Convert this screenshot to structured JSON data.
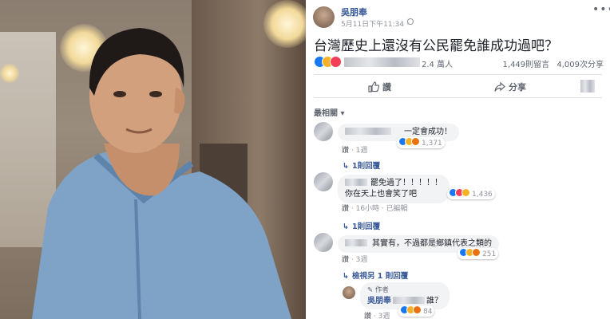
{
  "post": {
    "author": "吳朋奉",
    "time": "5月11日下午11:34 ·",
    "text": "台灣歷史上還沒有公民罷免誰成功過吧？",
    "reaction_count": "2.4 萬人",
    "comments_count": "1,449則留言",
    "shares_count": "4,009次分享"
  },
  "actions": {
    "like": "讚",
    "share": "分享"
  },
  "sort_label": "最相關 ▾",
  "comments": [
    {
      "text": "一定會成功！",
      "like": "讚",
      "age": "1週",
      "reactions": "1,371",
      "replies": "1則回覆"
    },
    {
      "text_line1": "罷免過了！！！！！",
      "text_line2": "你在天上也會笑了吧",
      "like": "讚",
      "age": "16小時",
      "edited": "已編輯",
      "reactions": "1,436",
      "replies": "1則回覆"
    },
    {
      "text": "其實有，不過都是鄉鎮代表之類的",
      "like": "讚",
      "age": "3週",
      "reactions": "251",
      "replies": "檢視另 1 則回覆"
    }
  ],
  "reply": {
    "author_tag": "作者",
    "name": "吳朋奉",
    "text": "誰？",
    "like": "讚",
    "age": "3週",
    "reactions": "84"
  },
  "colors": {
    "link": "#385898",
    "like": "#1877f2",
    "love": "#f33e58",
    "haha": "#f7b125",
    "angry": "#e9710f",
    "bubble": "#f2f3f5"
  }
}
